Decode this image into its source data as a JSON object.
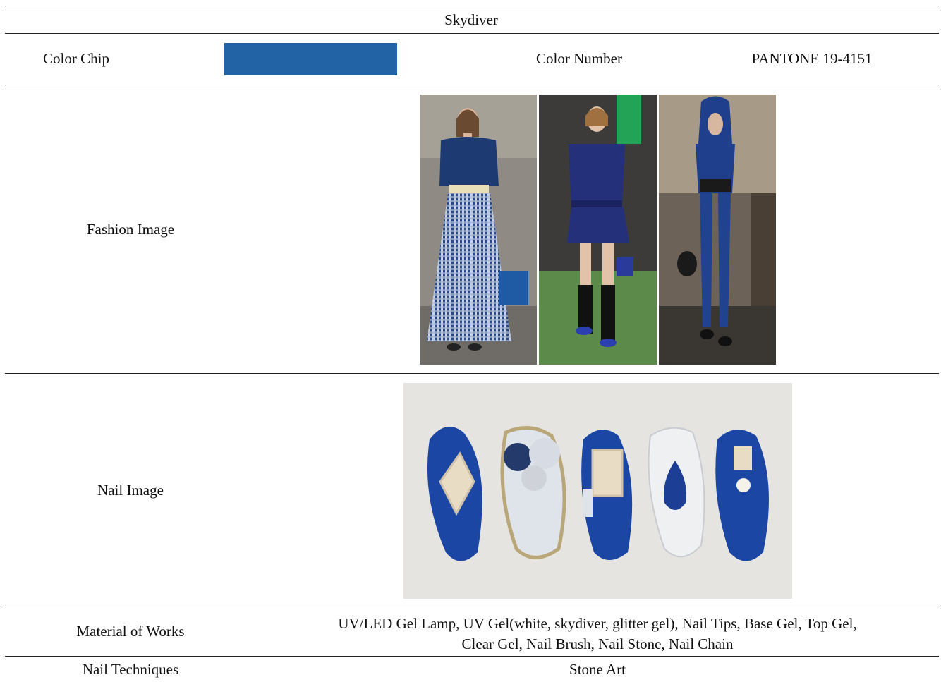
{
  "title": "Skydiver",
  "color_chip": {
    "label": "Color Chip",
    "swatch_color": "#2163a5",
    "number_label": "Color Number",
    "number_value": "PANTONE 19-4151"
  },
  "fashion": {
    "label": "Fashion Image"
  },
  "nail": {
    "label": "Nail Image"
  },
  "material": {
    "label": "Material of Works",
    "line1": "UV/LED Gel Lamp, UV Gel(white, skydiver, glitter gel), Nail Tips, Base Gel, Top Gel,",
    "line2": "Clear Gel, Nail Brush, Nail Stone, Nail Chain"
  },
  "techniques": {
    "label": "Nail Techniques",
    "value": "Stone Art"
  },
  "colors": {
    "skydiver": "#2163a5",
    "navy": "#1e2f6e",
    "cobalt": "#1d47a0"
  }
}
